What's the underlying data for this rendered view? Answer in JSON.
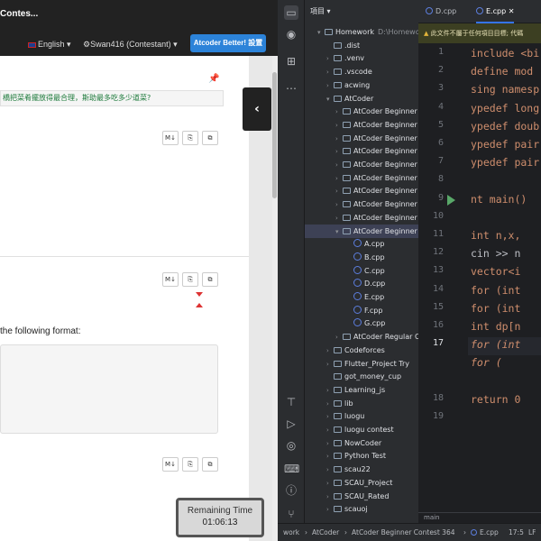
{
  "browser": {
    "brand": "Contes...",
    "nav": {
      "language": "English",
      "user": "Swan416 (Contestant)",
      "better_button": "Atcoder Better! 設置"
    },
    "problem_text_cn": "橋把菜肴擺放得最合理，斯助最多吃多少道菜?",
    "format_text": "the following format:",
    "toolbar": {
      "md": "M↓",
      "copy": "⎘",
      "dup": "⧉"
    },
    "timer": {
      "label": "Remaining Time",
      "value": "01:06:13"
    },
    "collapse_icon": "‹"
  },
  "ide": {
    "panel_title": "項目",
    "tabs": [
      {
        "label": "D.cpp",
        "active": false
      },
      {
        "label": "E.cpp",
        "active": true
      }
    ],
    "warning": "此文件不屬于任何項目目標; 代碼",
    "tree": [
      {
        "label": "Homework",
        "dim": "D:\\Homework",
        "depth": 0,
        "arrow": "▾",
        "kind": "folder"
      },
      {
        "label": ".dist",
        "depth": 1,
        "arrow": "",
        "kind": "folder"
      },
      {
        "label": ".venv",
        "depth": 1,
        "arrow": "›",
        "kind": "folder"
      },
      {
        "label": ".vscode",
        "depth": 1,
        "arrow": "›",
        "kind": "folder"
      },
      {
        "label": "acwing",
        "depth": 1,
        "arrow": "›",
        "kind": "folder"
      },
      {
        "label": "AtCoder",
        "depth": 1,
        "arrow": "▾",
        "kind": "folder"
      },
      {
        "label": "AtCoder Beginner C",
        "depth": 2,
        "arrow": "›",
        "kind": "folder"
      },
      {
        "label": "AtCoder Beginner C",
        "depth": 2,
        "arrow": "›",
        "kind": "folder"
      },
      {
        "label": "AtCoder Beginner C",
        "depth": 2,
        "arrow": "›",
        "kind": "folder"
      },
      {
        "label": "AtCoder Beginner C",
        "depth": 2,
        "arrow": "›",
        "kind": "folder"
      },
      {
        "label": "AtCoder Beginner C",
        "depth": 2,
        "arrow": "›",
        "kind": "folder"
      },
      {
        "label": "AtCoder Beginner C",
        "depth": 2,
        "arrow": "›",
        "kind": "folder"
      },
      {
        "label": "AtCoder Beginner C",
        "depth": 2,
        "arrow": "›",
        "kind": "folder"
      },
      {
        "label": "AtCoder Beginner C",
        "depth": 2,
        "arrow": "›",
        "kind": "folder"
      },
      {
        "label": "AtCoder Beginner C",
        "depth": 2,
        "arrow": "›",
        "kind": "folder"
      },
      {
        "label": "AtCoder Beginner C",
        "depth": 2,
        "arrow": "▾",
        "kind": "folder",
        "selected": true
      },
      {
        "label": "A.cpp",
        "depth": 3,
        "arrow": "",
        "kind": "cpp"
      },
      {
        "label": "B.cpp",
        "depth": 3,
        "arrow": "",
        "kind": "cpp"
      },
      {
        "label": "C.cpp",
        "depth": 3,
        "arrow": "",
        "kind": "cpp"
      },
      {
        "label": "D.cpp",
        "depth": 3,
        "arrow": "",
        "kind": "cpp"
      },
      {
        "label": "E.cpp",
        "depth": 3,
        "arrow": "",
        "kind": "cpp"
      },
      {
        "label": "F.cpp",
        "depth": 3,
        "arrow": "",
        "kind": "cpp"
      },
      {
        "label": "G.cpp",
        "depth": 3,
        "arrow": "",
        "kind": "cpp"
      },
      {
        "label": "AtCoder Regular Co",
        "depth": 2,
        "arrow": "›",
        "kind": "folder"
      },
      {
        "label": "Codeforces",
        "depth": 1,
        "arrow": "›",
        "kind": "folder"
      },
      {
        "label": "Flutter_Project Try",
        "depth": 1,
        "arrow": "›",
        "kind": "folder"
      },
      {
        "label": "got_money_cup",
        "depth": 1,
        "arrow": "",
        "kind": "folder"
      },
      {
        "label": "Learning_js",
        "depth": 1,
        "arrow": "›",
        "kind": "folder"
      },
      {
        "label": "lib",
        "depth": 1,
        "arrow": "›",
        "kind": "folder"
      },
      {
        "label": "luogu",
        "depth": 1,
        "arrow": "›",
        "kind": "folder"
      },
      {
        "label": "luogu contest",
        "depth": 1,
        "arrow": "›",
        "kind": "folder"
      },
      {
        "label": "NowCoder",
        "depth": 1,
        "arrow": "›",
        "kind": "folder"
      },
      {
        "label": "Python Test",
        "depth": 1,
        "arrow": "›",
        "kind": "folder"
      },
      {
        "label": "scau22",
        "depth": 1,
        "arrow": "›",
        "kind": "folder"
      },
      {
        "label": "SCAU_Project",
        "depth": 1,
        "arrow": "›",
        "kind": "folder"
      },
      {
        "label": "SCAU_Rated",
        "depth": 1,
        "arrow": "›",
        "kind": "folder"
      },
      {
        "label": "scauoj",
        "depth": 1,
        "arrow": "›",
        "kind": "folder"
      }
    ],
    "line_numbers": [
      "1",
      "2",
      "3",
      "4",
      "5",
      "6",
      "7",
      "8",
      "9",
      "10",
      "11",
      "12",
      "13",
      "14",
      "15",
      "16",
      "17",
      "",
      "",
      "18",
      "19"
    ],
    "current_line": "17",
    "code_lines": [
      "include <bi",
      "define mod",
      "sing namesp",
      "ypedef long",
      "ypedef doub",
      "ypedef pair",
      "ypedef pair",
      "",
      "nt main()",
      "",
      "    int n,x,",
      "    cin >> n",
      "    vector<i",
      "    for (int",
      "    for (int",
      "    int dp[n",
      "    for (int",
      "        for (",
      "",
      "    return 0",
      ""
    ],
    "fold_label": "main",
    "status": {
      "path1": "work",
      "path2": "AtCoder",
      "path3": "AtCoder Beginner Contest 364",
      "file": "E.cpp",
      "position": "17:5",
      "lf": "LF"
    }
  }
}
